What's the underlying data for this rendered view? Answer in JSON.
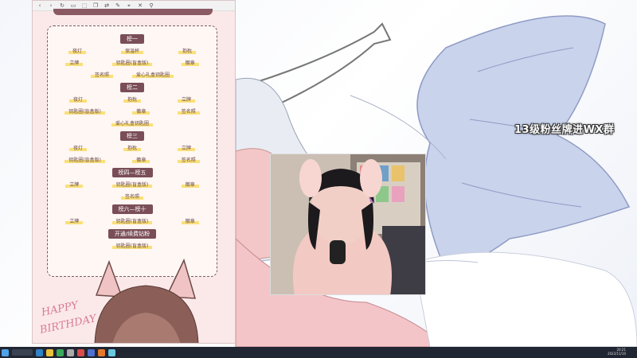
{
  "overlay": {
    "banner_text": "13级粉丝牌进WX群"
  },
  "browser": {
    "toolbar_icons": [
      "back-icon",
      "forward-icon",
      "reload-icon",
      "tabs-icon",
      "screenshot-icon",
      "copy-icon",
      "translate-icon",
      "edit-icon",
      "pin-icon",
      "close-icon",
      "link-icon"
    ]
  },
  "gift_card": {
    "sections": [
      {
        "title": "榜一",
        "rows": [
          [
            "夜灯",
            "保温杯",
            "抱枕"
          ],
          [
            "立牌",
            "钥匙圈(盲盒版)",
            "徽章"
          ],
          [
            "签名照",
            "爱心礼盒钥匙圈"
          ]
        ]
      },
      {
        "title": "榜二",
        "rows": [
          [
            "夜灯",
            "抱枕",
            "立牌"
          ],
          [
            "钥匙圈(盲盒版)",
            "徽章",
            "签名照"
          ],
          [
            "爱心礼盒钥匙圈"
          ]
        ]
      },
      {
        "title": "榜三",
        "rows": [
          [
            "夜灯",
            "抱枕",
            "立牌"
          ],
          [
            "钥匙圈(盲盒版)",
            "徽章",
            "签名照"
          ]
        ]
      },
      {
        "title": "榜四—榜五",
        "rows": [
          [
            "立牌",
            "钥匙圈(盲盒版)",
            "徽章"
          ],
          [
            "签名照"
          ]
        ]
      },
      {
        "title": "榜六—榜十",
        "rows": [
          [
            "立牌",
            "钥匙圈(盲盒版)",
            "徽章"
          ]
        ]
      },
      {
        "title": "开通/续费钻粉",
        "rows": [
          [
            "钥匙圈(盲盒版)"
          ]
        ]
      }
    ]
  },
  "birthday": {
    "line1": "HAPPY",
    "line2": "BIRTHDAY"
  },
  "taskbar": {
    "clock_time": "20:21",
    "clock_date": "2022/11/10"
  },
  "colors": {
    "card_border": "#7a5a60",
    "section_head": "#7a4e57",
    "highlight": "#f9e07a",
    "taskbar": "#202632"
  }
}
